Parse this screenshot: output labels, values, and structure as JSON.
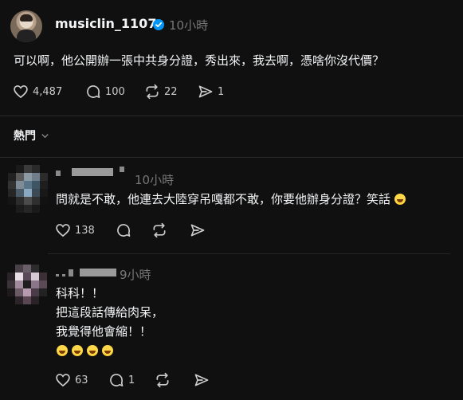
{
  "post": {
    "username": "musiclin_1107",
    "time": "10小時",
    "text": "可以啊，他公開辦一張中共身分證，秀出來，我去啊，憑啥你沒代價？",
    "likes": "4,487",
    "comments": "100",
    "reposts": "22",
    "shares": "1"
  },
  "filter": {
    "label": "熱門"
  },
  "replies": [
    {
      "username_hidden": "▘ ▀▀▀▀ ▝",
      "time": "10小時",
      "text": "問就是不敢，他連去大陸穿吊嘎都不敢，你要他辦身分證？笑話",
      "likes": "138"
    },
    {
      "username_hidden": "▖▗ ▀▀▀▀▀",
      "time": "9小時",
      "lines": [
        "科科！！",
        "把這段話傳給肉呆，",
        "我覺得他會縮！！"
      ],
      "emoji_count": 4,
      "likes": "63",
      "comments": "1"
    }
  ],
  "colors": {
    "background": "#101010",
    "text": "#f3f5f7",
    "muted": "#777777",
    "verified": "#0095f6"
  },
  "icons": [
    "heart-icon",
    "comment-icon",
    "repost-icon",
    "share-icon",
    "chevron-down-icon",
    "verified-badge-icon"
  ]
}
